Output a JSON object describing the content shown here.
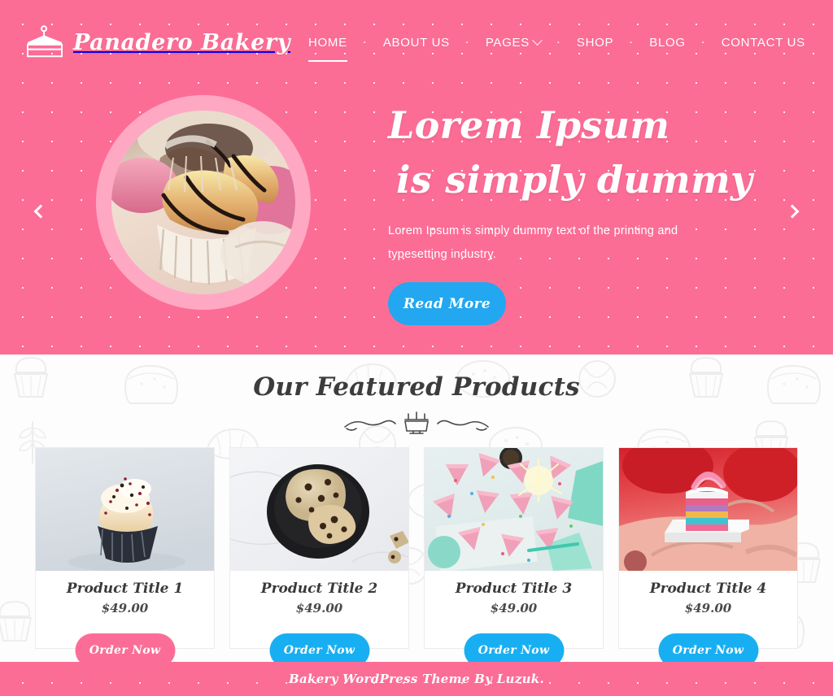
{
  "brand": {
    "name": "Panadero Bakery",
    "logo_icon": "cake-slice-icon"
  },
  "nav": {
    "items": [
      {
        "label": "HOME",
        "active": true,
        "has_caret": false
      },
      {
        "label": "ABOUT US",
        "active": false,
        "has_caret": false
      },
      {
        "label": "PAGES",
        "active": false,
        "has_caret": true
      },
      {
        "label": "SHOP",
        "active": false,
        "has_caret": false
      },
      {
        "label": "BLOG",
        "active": false,
        "has_caret": false
      },
      {
        "label": "CONTACT US",
        "active": false,
        "has_caret": false
      }
    ]
  },
  "hero": {
    "title_line1": "Lorem Ipsum",
    "title_line2": "is simply dummy",
    "description": "Lorem Ipsum is simply dummy text of the printing and typesetting industry.",
    "button_label": "Read More",
    "image_alt": "assorted cupcakes with chocolate drizzle in paper cases",
    "prev_icon": "chevron-left-icon",
    "next_icon": "chevron-right-icon"
  },
  "featured": {
    "title": "Our Featured Products",
    "divider_icon": "cake-with-candles-divider-icon",
    "products": [
      {
        "title": "Product Title 1",
        "price": "$49.00",
        "button_label": "Order Now",
        "button_state": "hover",
        "image_alt": "vanilla frosted cupcake with red sprinkles"
      },
      {
        "title": "Product Title 2",
        "price": "$49.00",
        "button_label": "Order Now",
        "button_state": "default",
        "image_alt": "chocolate chip cookies on a black plate"
      },
      {
        "title": "Product Title 3",
        "price": "$49.00",
        "button_label": "Order Now",
        "button_state": "default",
        "image_alt": "pink sprinkle cake slices with sparkler"
      },
      {
        "title": "Product Title 4",
        "price": "$49.00",
        "button_label": "Order Now",
        "button_state": "default",
        "image_alt": "rainbow layer cake slice on white plate"
      }
    ]
  },
  "footer": {
    "text": "Bakery WordPress Theme By Luzuk."
  },
  "colors": {
    "brand_pink": "#fc6d96",
    "ring_pink": "#ffa8c4",
    "accent_blue": "#22a7f0",
    "order_blue": "#18aff2",
    "order_pink": "#fb6d97",
    "section_bg": "#fdfdfd",
    "text_dark": "#3c3c3c"
  }
}
